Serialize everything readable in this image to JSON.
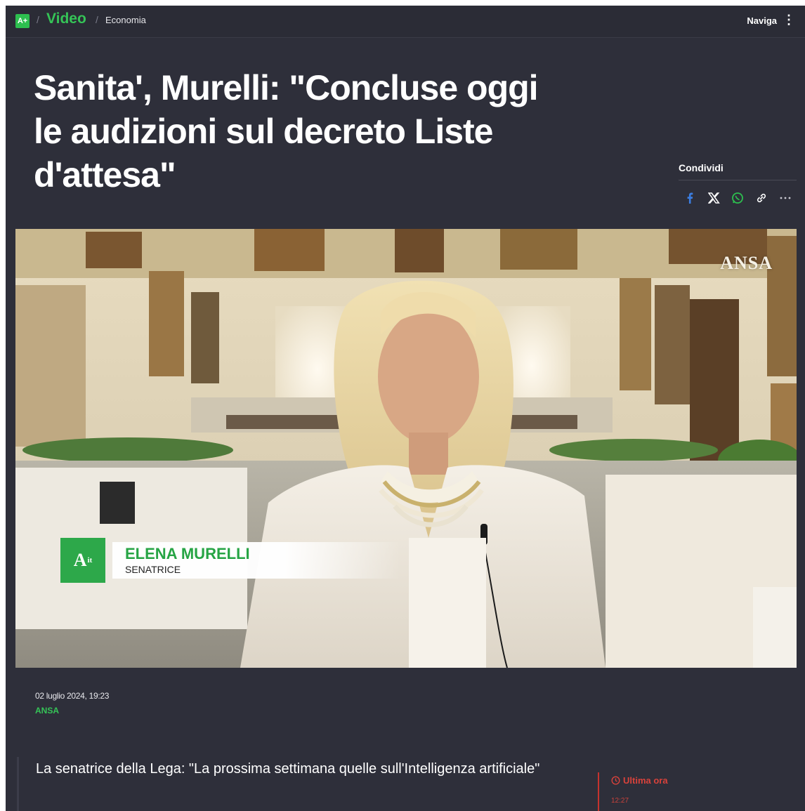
{
  "header": {
    "logo_text": "A+",
    "breadcrumb_sep": "/",
    "section_video": "Video",
    "section_sub": "Economia",
    "menu_label": "Naviga",
    "menu_icon": "kebab-icon"
  },
  "article": {
    "title": "Sanita', Murelli: \"Concluse oggi le audizioni sul decreto Liste d'attesa\"",
    "date": "02 luglio 2024, 19:23",
    "source": "ANSA",
    "subtitle": "La senatrice della Lega: \"La prossima settimana quelle sull'Intelligenza artificiale\""
  },
  "share": {
    "label": "Condividi",
    "icons": [
      "facebook-icon",
      "x-icon",
      "whatsapp-icon",
      "link-icon",
      "more-icon"
    ]
  },
  "video": {
    "watermark": "ANSA",
    "lower_third_logo": "A",
    "lower_third_logo_sup": "it",
    "person_name": "ELENA MURELLI",
    "person_role": "SENATRICE"
  },
  "latest": {
    "label": "Ultima ora",
    "time": "12:27"
  },
  "colors": {
    "background": "#2e2f3a",
    "accent_green": "#35c457",
    "latest_red": "#d9423b"
  }
}
